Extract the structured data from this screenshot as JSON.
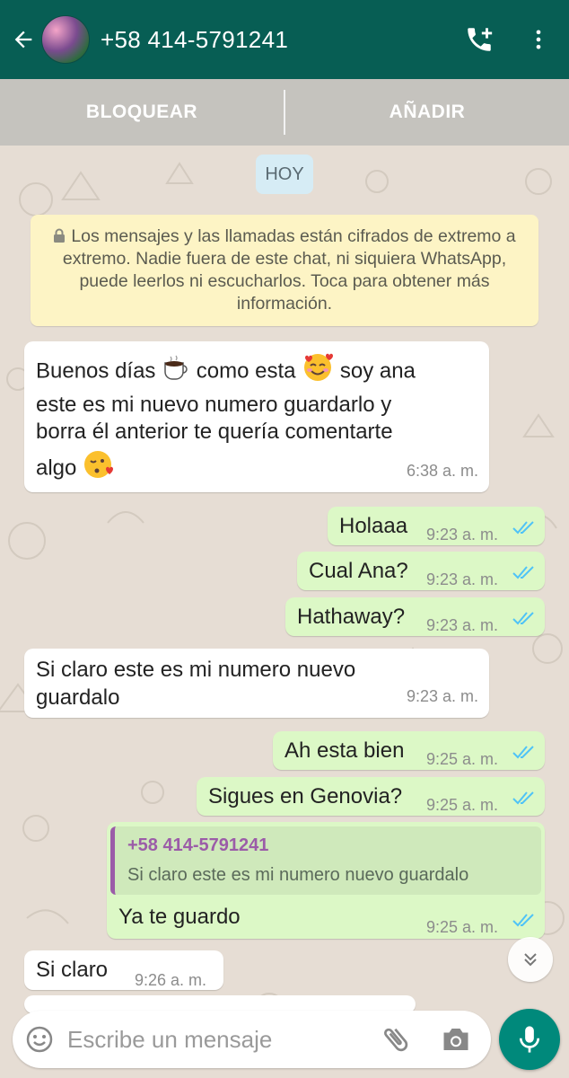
{
  "header": {
    "contact_name": "+58 414-5791241",
    "icons": {
      "back": "arrow-left-icon",
      "call": "add-call-icon",
      "menu": "more-vertical-icon"
    },
    "color": "#075e54"
  },
  "actions": {
    "block": "BLOQUEAR",
    "add": "AÑADIR"
  },
  "chat": {
    "date_chip": "HOY",
    "encryption_notice": "Los mensajes y las llamadas están cifrados de extremo a extremo. Nadie fuera de este chat, ni siquiera WhatsApp, puede leerlos ni escucharlos. Toca para obtener más información.",
    "messages": [
      {
        "dir": "in",
        "lines": [
          "Buenos días",
          "como esta",
          "soy ana",
          "este es mi nuevo numero guardarlo y",
          "borra él anterior te quería comentarte",
          "algo"
        ],
        "time": "6:38 a. m."
      },
      {
        "dir": "out",
        "text": "Holaaa",
        "time": "9:23 a. m."
      },
      {
        "dir": "out",
        "text": "Cual Ana?",
        "time": "9:23 a. m."
      },
      {
        "dir": "out",
        "text": "Hathaway?",
        "time": "9:23 a. m."
      },
      {
        "dir": "in",
        "lines": [
          "Si claro este es mi numero nuevo",
          "guardalo"
        ],
        "time": "9:23 a. m."
      },
      {
        "dir": "out",
        "text": "Ah esta bien",
        "time": "9:25 a. m."
      },
      {
        "dir": "out",
        "text": "Sigues en Genovia?",
        "time": "9:25 a. m."
      },
      {
        "dir": "out",
        "quote_name": "+58 414-5791241",
        "quote_text": "Si claro este es mi numero nuevo guardalo",
        "text": "Ya te guardo",
        "time": "9:25 a. m."
      },
      {
        "dir": "in",
        "text": "Si claro",
        "time": "9:26 a. m."
      }
    ]
  },
  "composer": {
    "placeholder": "Escribe un mensaje",
    "icons": {
      "emoji": "emoji-icon",
      "attach": "paperclip-icon",
      "camera": "camera-icon",
      "mic": "mic-icon",
      "scroll": "chevron-double-down-icon"
    },
    "accent": "#00897b"
  }
}
